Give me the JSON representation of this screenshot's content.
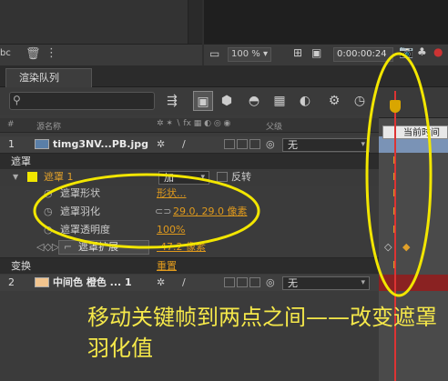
{
  "top": {
    "left_label": "bc",
    "zoom": "100 %",
    "timecode": "0:00:00:24"
  },
  "tabs": {
    "render_queue": "渲染队列"
  },
  "columns": {
    "num": "#",
    "source_name": "源名称",
    "parent": "父级"
  },
  "layers": [
    {
      "num": "1",
      "name": "timg3NV...PB.jpg",
      "parent": "无"
    },
    {
      "num": "2",
      "name": "中间色 橙色 ... 1",
      "parent": "无"
    }
  ],
  "mask_group": "遮罩",
  "mask": {
    "name": "遮罩 1",
    "mode": "加",
    "invert": "反转",
    "shape_label": "遮罩形状",
    "shape_value": "形状...",
    "feather_label": "遮罩羽化",
    "feather_value": "29.0, 29.0 像素",
    "opacity_label": "遮罩透明度",
    "opacity_value": "100%",
    "expansion_label": "遮罩扩展",
    "expansion_value": "-47.2 像素"
  },
  "transform": {
    "label": "变换",
    "value": "重置"
  },
  "timeline": {
    "current_time_label": "当前时间"
  },
  "caption": "移动关键帧到两点之间——改变遮罩羽化值",
  "colors": {
    "highlight_ellipse": "#f2e600",
    "caption": "#f5e84a",
    "keyframe": "#e0a02a",
    "playhead": "#dd3333"
  }
}
